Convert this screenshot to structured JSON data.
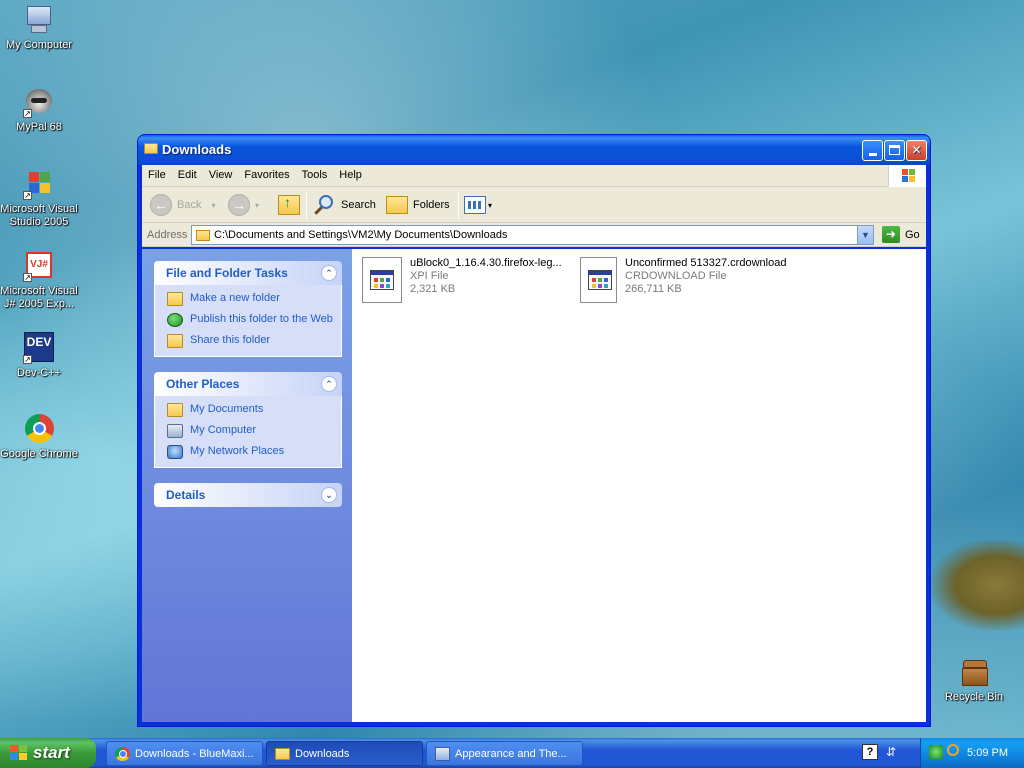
{
  "desktop": {
    "icons": [
      {
        "label": "My Computer",
        "icon": "computer-icon"
      },
      {
        "label": "MyPal 68",
        "icon": "raccoon-icon"
      },
      {
        "label": "Microsoft Visual Studio 2005",
        "icon": "visual-studio-icon"
      },
      {
        "label": "Microsoft Visual J# 2005 Exp...",
        "icon": "vj-sharp-icon"
      },
      {
        "label": "Dev-C++",
        "icon": "dev-cpp-icon",
        "badge": "DEV"
      },
      {
        "label": "Google Chrome",
        "icon": "chrome-icon"
      },
      {
        "label": "Recycle Bin",
        "icon": "recycle-bin-icon"
      }
    ],
    "vj_badge": "VJ#"
  },
  "window": {
    "title": "Downloads",
    "menu": [
      "File",
      "Edit",
      "View",
      "Favorites",
      "Tools",
      "Help"
    ],
    "toolbar": {
      "back": "Back",
      "search": "Search",
      "folders": "Folders"
    },
    "address": {
      "label": "Address",
      "value": "C:\\Documents and Settings\\VM2\\My Documents\\Downloads",
      "go": "Go"
    },
    "taskpane": {
      "file_tasks": {
        "title": "File and Folder Tasks",
        "items": [
          "Make a new folder",
          "Publish this folder to the Web",
          "Share this folder"
        ]
      },
      "other_places": {
        "title": "Other Places",
        "items": [
          "My Documents",
          "My Computer",
          "My Network Places"
        ]
      },
      "details": {
        "title": "Details"
      }
    },
    "files": [
      {
        "name": "uBlock0_1.16.4.30.firefox-leg...",
        "type": "XPI File",
        "size": "2,321 KB"
      },
      {
        "name": "Unconfirmed 513327.crdownload",
        "type": "CRDOWNLOAD File",
        "size": "266,711 KB"
      }
    ]
  },
  "taskbar": {
    "start": "start",
    "buttons": [
      {
        "label": "Downloads - BlueMaxi...",
        "icon": "chrome-icon",
        "active": false
      },
      {
        "label": "Downloads",
        "icon": "folder-icon",
        "active": true
      },
      {
        "label": "Appearance and The...",
        "icon": "control-panel-icon",
        "active": false
      }
    ],
    "clock": "5:09 PM",
    "help_glyph": "?"
  },
  "colors": {
    "titlebar": "#0855dd",
    "taskpane": "#6375d6",
    "link": "#215dc6",
    "start": "#3a9b3a"
  }
}
